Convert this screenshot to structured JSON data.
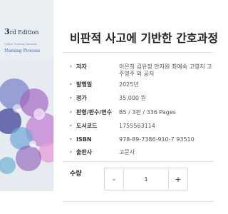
{
  "cover": {
    "edition_number": "3",
    "edition_text": "rd Edition",
    "small_text": "Critical Thinking Concepts",
    "subtitle": "Nursing Process"
  },
  "product": {
    "title": "비판적 사고에 기반한 간호과정"
  },
  "details": [
    {
      "label": "저자",
      "value": "이은희 김유정 안지원 최예숙 고영지 고 주영주 외 공저"
    },
    {
      "label": "발행일",
      "value": "2025년"
    },
    {
      "label": "정가",
      "value": "35,000 원"
    },
    {
      "label": "판형/판수/면수",
      "value": "B5 / 3판 / 336 Pages"
    },
    {
      "label": "도서코드",
      "value": "1755563114"
    },
    {
      "label": "ISBN",
      "value": "978-89-7386-910-7 93510"
    },
    {
      "label": "출판사",
      "value": "고문사"
    }
  ],
  "quantity": {
    "label": "수량",
    "value": "1",
    "minus": "-",
    "plus": "+"
  }
}
